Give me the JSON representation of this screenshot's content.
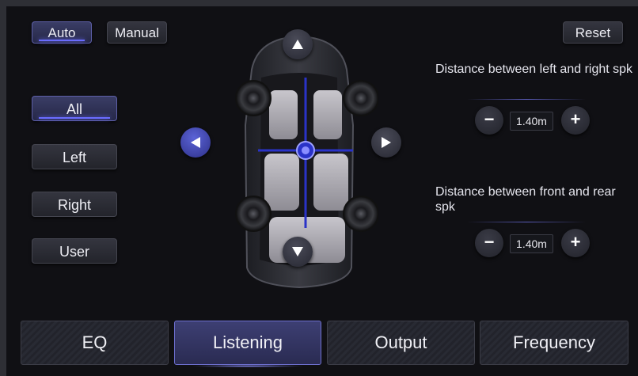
{
  "mode": {
    "auto_label": "Auto",
    "manual_label": "Manual",
    "selected": "Auto"
  },
  "reset_label": "Reset",
  "side_buttons": [
    {
      "label": "All",
      "active": true
    },
    {
      "label": "Left",
      "active": false
    },
    {
      "label": "Right",
      "active": false
    },
    {
      "label": "User",
      "active": false
    }
  ],
  "distance_lr": {
    "label": "Distance between left and right spk",
    "value": "1.40m",
    "minus": "−",
    "plus": "+"
  },
  "distance_fr": {
    "label": "Distance between front and rear spk",
    "value": "1.40m",
    "minus": "−",
    "plus": "+"
  },
  "tabs": [
    {
      "label": "EQ",
      "active": false
    },
    {
      "label": "Listening",
      "active": true
    },
    {
      "label": "Output",
      "active": false
    },
    {
      "label": "Frequency",
      "active": false
    }
  ],
  "icons": {
    "up": "triangle-up-icon",
    "down": "triangle-down-icon",
    "left": "triangle-left-icon",
    "right": "triangle-right-icon"
  },
  "colors": {
    "accent": "#6a6cff",
    "focus_line": "#2a33c8",
    "background": "#101014"
  }
}
